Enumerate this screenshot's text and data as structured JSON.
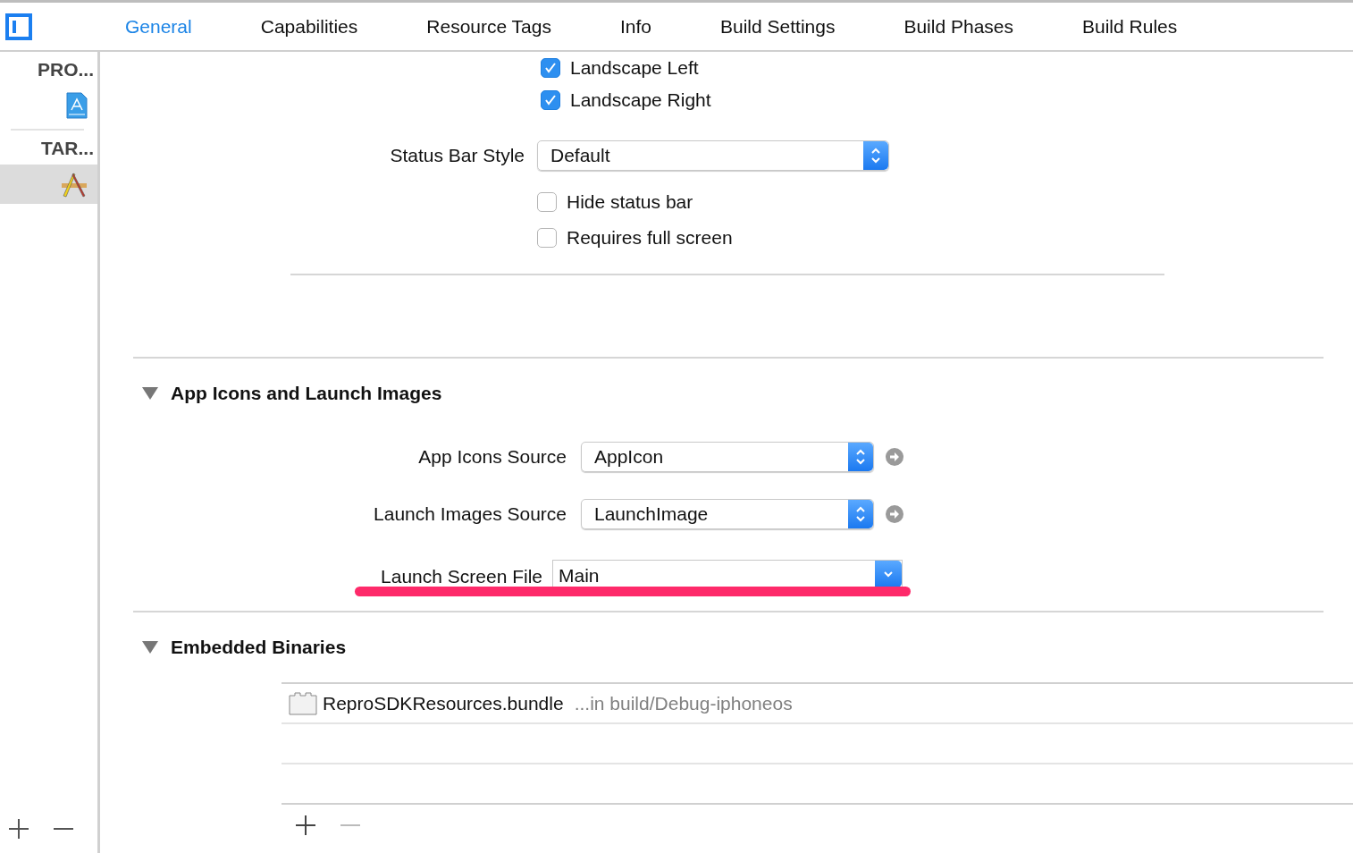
{
  "tabs": [
    {
      "label": "General",
      "selected": true
    },
    {
      "label": "Capabilities",
      "selected": false
    },
    {
      "label": "Resource Tags",
      "selected": false
    },
    {
      "label": "Info",
      "selected": false
    },
    {
      "label": "Build Settings",
      "selected": false
    },
    {
      "label": "Build Phases",
      "selected": false
    },
    {
      "label": "Build Rules",
      "selected": false
    }
  ],
  "sidebar": {
    "sections": [
      {
        "heading": "PRO...",
        "items": [
          {
            "kind": "project",
            "selected": false
          }
        ]
      },
      {
        "heading": "TAR...",
        "items": [
          {
            "kind": "target",
            "selected": true
          }
        ]
      }
    ]
  },
  "orientations": [
    {
      "label": "Landscape Left",
      "checked": true
    },
    {
      "label": "Landscape Right",
      "checked": true
    }
  ],
  "status_bar_style": {
    "label": "Status Bar Style",
    "value": "Default"
  },
  "status_options": [
    {
      "label": "Hide status bar",
      "checked": false
    },
    {
      "label": "Requires full screen",
      "checked": false
    }
  ],
  "app_icons_section": {
    "title": "App Icons and Launch Images",
    "expanded": true,
    "rows": [
      {
        "label": "App Icons Source",
        "value": "AppIcon",
        "kind": "popup",
        "underlined": false
      },
      {
        "label": "Launch Images Source",
        "value": "LaunchImage",
        "kind": "popup",
        "underlined": false
      },
      {
        "label": "Launch Screen File",
        "value": "Main",
        "kind": "combo",
        "underlined": true
      }
    ]
  },
  "embedded_binaries": {
    "title": "Embedded Binaries",
    "expanded": true,
    "items": [
      {
        "name": "ReproSDKResources.bundle",
        "location": "...in build/Debug-iphoneos"
      }
    ],
    "remove_disabled": true
  }
}
